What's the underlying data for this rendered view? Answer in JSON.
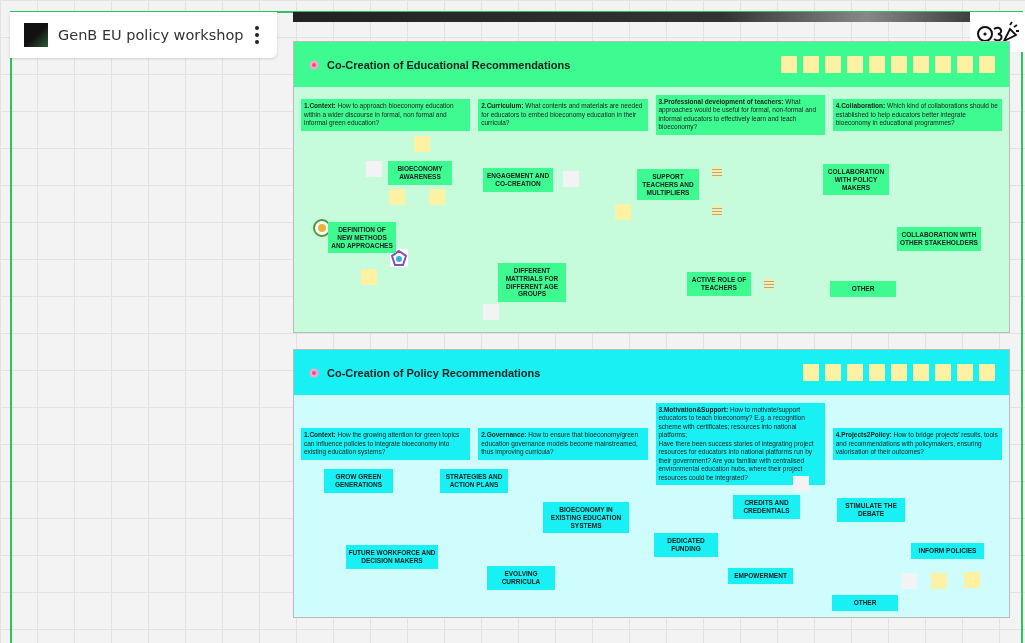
{
  "board": {
    "title": "GenB EU policy workshop"
  },
  "frames": [
    {
      "kind": "green",
      "title": "Co-Creation of Educational Recommendations",
      "questions": [
        "**1.Context:** How to approach bioeconomy education within a wider discourse in formal, non formal and informal green education?",
        "**2.Curriculum:** What contents and materials are needed for educators to embed bioeconomy education in their curricula?",
        "**3.Professional development of teachers:** What approaches would be useful for formal, non-formal and informal educators to effectively learn and teach bioeconomy?",
        "**4.Collaboration:** Which kind of collaborations should be established to help educators better integrate bioeconomy in educational programmes?"
      ],
      "clusters": [
        "BIOECONOMY AWARENESS",
        "ENGAGEMENT AND CO-CREATION",
        "SUPPORT TEACHERS AND MULTIPLIERS",
        "COLLABORATION WITH POLICY MAKERS",
        "DEFINITION OF NEW METHODS AND APPROACHES",
        "DIFFERENT MATTRIALS FOR DIFFERENT AGE GROUPS",
        "ACTIVE ROLE OF TEACHERS",
        "COLLABORATION WITH OTHER STAKEHOLDERS",
        "OTHER"
      ]
    },
    {
      "kind": "cyan",
      "title": "Co-Creation of Policy Recommendations",
      "questions": [
        "**1.Context:** How the growing attention for green topics can influence policies to integrate bioeconomy into existing education systems?",
        "**2.Governance:** How to ensure that bioeconomy/green education governance models become mainstreamed, thus improving curricula?",
        "**3.Motivation&Support:** How to motivate/support educators to teach bioeconomy? E.g. a recognition scheme with certificates; resources into national platforms;\nHave there been success stories of integrating project resources for educators into national platforms run by their government? Are you familiar with centralised environmental education hubs, where their project resources could be integrated?",
        "**4.Projects2Policy:** How to bridge projects' results, tools and recommendations with policymakers, ensuring valorisation of their outcomes?"
      ],
      "clusters": [
        "GROW GREEN GENERATIONS",
        "STRATEGIES AND ACTION PLANS",
        "BIOECONOMY IN EXISTING EDUCATION SYSTEMS",
        "CREDITS AND CREDENTIALS",
        "STIMULATE THE DEBATE",
        "DEDICATED FUNDING",
        "FUTURE WORKFORCE AND DECISION MAKERS",
        "EVOLVING CURRICULA",
        "EMPOWERMENT",
        "INFORM POLICIES",
        "OTHER"
      ]
    }
  ]
}
